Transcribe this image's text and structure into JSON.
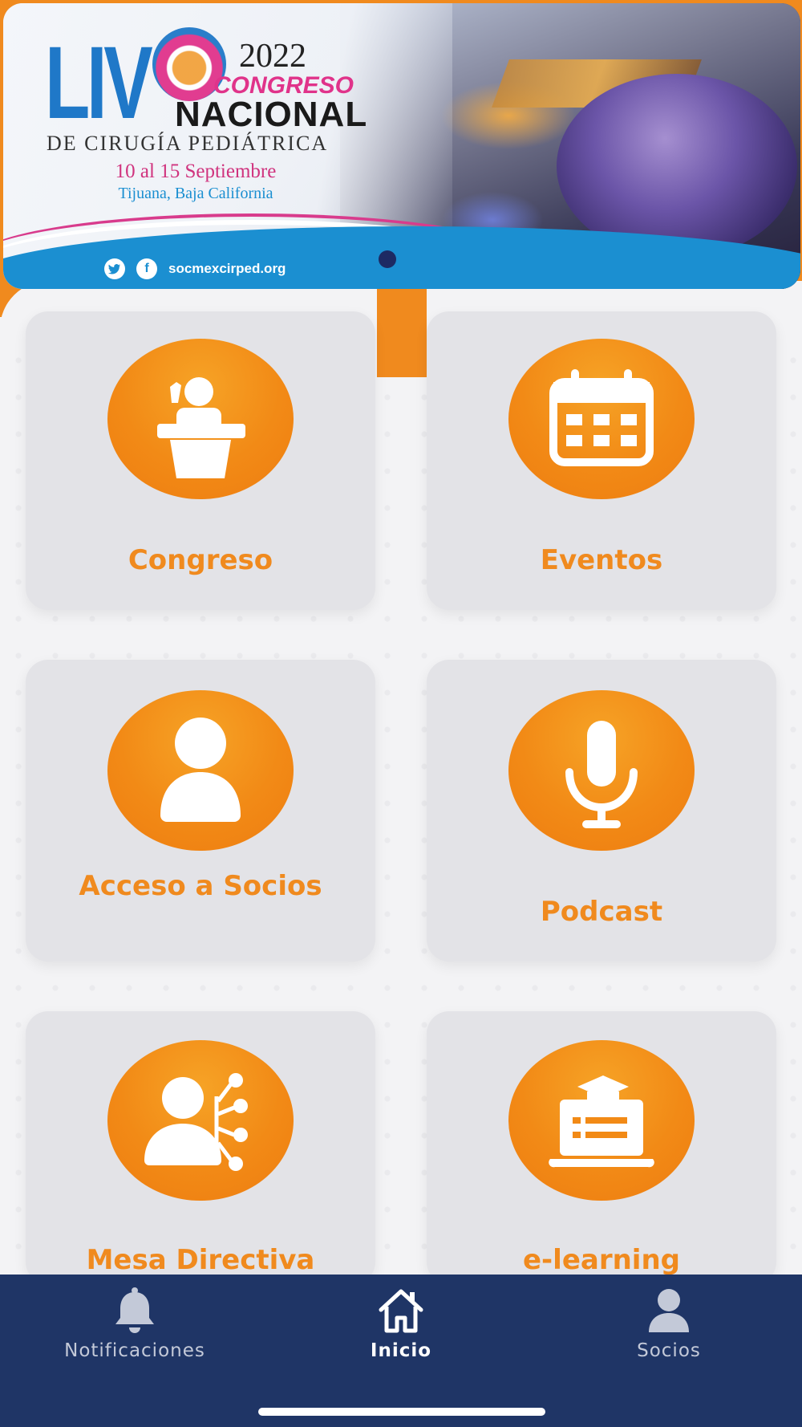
{
  "banner": {
    "liv": "LIV",
    "year": "2022",
    "congreso": "CONGRESO",
    "nacional": "NACIONAL",
    "cirugia": "DE CIRUGÍA PEDIÁTRICA",
    "dates": "10 al 15 Septiembre",
    "place": "Tijuana, Baja California",
    "social_twitter_icon": "twitter-icon",
    "social_facebook_icon": "facebook-icon",
    "website": "socmexcirped.org",
    "active_slide": 1
  },
  "tiles": [
    {
      "label": "Congreso",
      "icon": "podium-speaker-icon"
    },
    {
      "label": "Eventos",
      "icon": "calendar-icon"
    },
    {
      "label": "Acceso a Socios",
      "icon": "user-icon"
    },
    {
      "label": "Podcast",
      "icon": "microphone-icon"
    },
    {
      "label": "Mesa Directiva",
      "icon": "network-people-icon"
    },
    {
      "label": "e-learning",
      "icon": "laptop-graduation-icon"
    }
  ],
  "nav": {
    "items": [
      {
        "label": "Notificaciones",
        "icon": "bell-icon",
        "active": false
      },
      {
        "label": "Inicio",
        "icon": "home-icon",
        "active": true
      },
      {
        "label": "Socios",
        "icon": "user-icon",
        "active": false
      }
    ]
  },
  "colors": {
    "accent_orange": "#f08a1e",
    "nav_background": "#1f3566",
    "tile_background": "#e3e3e7",
    "banner_blue": "#1b8fd1",
    "banner_pink": "#d0337e"
  }
}
